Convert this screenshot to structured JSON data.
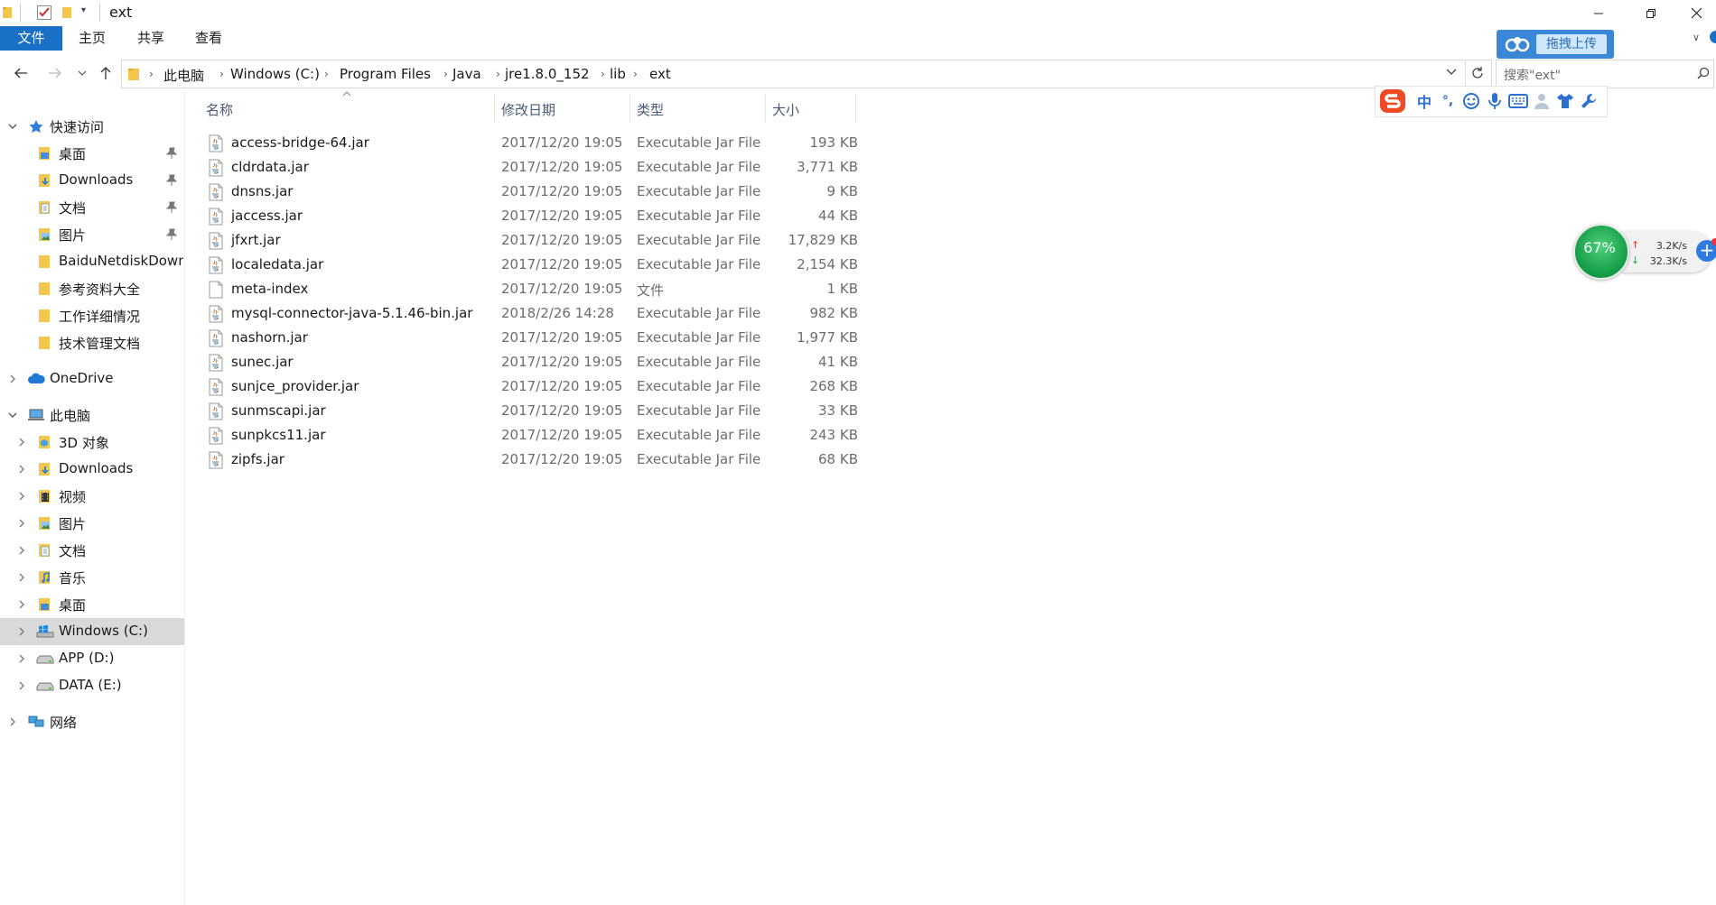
{
  "window": {
    "title": "ext"
  },
  "ribbon": {
    "tabs": [
      {
        "label": "文件",
        "active": true
      },
      {
        "label": "主页",
        "active": false
      },
      {
        "label": "共享",
        "active": false
      },
      {
        "label": "查看",
        "active": false
      }
    ]
  },
  "address": {
    "crumbs": [
      "此电脑",
      "Windows (C:)",
      "Program Files",
      "Java",
      "jre1.8.0_152",
      "lib",
      "ext"
    ]
  },
  "search": {
    "placeholder": "搜索\"ext\""
  },
  "baidu": {
    "label": "拖拽上传"
  },
  "ime": {
    "items": [
      "中",
      "°,",
      "☺",
      "mic",
      "keyboard",
      "user",
      "shirt",
      "wrench"
    ]
  },
  "columns": {
    "name": "名称",
    "date": "修改日期",
    "type": "类型",
    "size": "大小"
  },
  "files": [
    {
      "name": "access-bridge-64.jar",
      "date": "2017/12/20 19:05",
      "type": "Executable Jar File",
      "size": "193 KB",
      "icon": "jar-icon"
    },
    {
      "name": "cldrdata.jar",
      "date": "2017/12/20 19:05",
      "type": "Executable Jar File",
      "size": "3,771 KB",
      "icon": "jar-icon"
    },
    {
      "name": "dnsns.jar",
      "date": "2017/12/20 19:05",
      "type": "Executable Jar File",
      "size": "9 KB",
      "icon": "jar-icon"
    },
    {
      "name": "jaccess.jar",
      "date": "2017/12/20 19:05",
      "type": "Executable Jar File",
      "size": "44 KB",
      "icon": "jar-icon"
    },
    {
      "name": "jfxrt.jar",
      "date": "2017/12/20 19:05",
      "type": "Executable Jar File",
      "size": "17,829 KB",
      "icon": "jar-icon"
    },
    {
      "name": "localedata.jar",
      "date": "2017/12/20 19:05",
      "type": "Executable Jar File",
      "size": "2,154 KB",
      "icon": "jar-icon"
    },
    {
      "name": "meta-index",
      "date": "2017/12/20 19:05",
      "type": "文件",
      "size": "1 KB",
      "icon": "file-icon"
    },
    {
      "name": "mysql-connector-java-5.1.46-bin.jar",
      "date": "2018/2/26 14:28",
      "type": "Executable Jar File",
      "size": "982 KB",
      "icon": "jar-icon"
    },
    {
      "name": "nashorn.jar",
      "date": "2017/12/20 19:05",
      "type": "Executable Jar File",
      "size": "1,977 KB",
      "icon": "jar-icon"
    },
    {
      "name": "sunec.jar",
      "date": "2017/12/20 19:05",
      "type": "Executable Jar File",
      "size": "41 KB",
      "icon": "jar-icon"
    },
    {
      "name": "sunjce_provider.jar",
      "date": "2017/12/20 19:05",
      "type": "Executable Jar File",
      "size": "268 KB",
      "icon": "jar-icon"
    },
    {
      "name": "sunmscapi.jar",
      "date": "2017/12/20 19:05",
      "type": "Executable Jar File",
      "size": "33 KB",
      "icon": "jar-icon"
    },
    {
      "name": "sunpkcs11.jar",
      "date": "2017/12/20 19:05",
      "type": "Executable Jar File",
      "size": "243 KB",
      "icon": "jar-icon"
    },
    {
      "name": "zipfs.jar",
      "date": "2017/12/20 19:05",
      "type": "Executable Jar File",
      "size": "68 KB",
      "icon": "jar-icon"
    }
  ],
  "nav": [
    {
      "label": "快速访问",
      "icon": "star-icon",
      "level": 0,
      "chevron": "down"
    },
    {
      "label": "桌面",
      "icon": "desktop-folder-icon",
      "level": 1,
      "pinned": true
    },
    {
      "label": "Downloads",
      "icon": "downloads-folder-icon",
      "level": 1,
      "pinned": true
    },
    {
      "label": "文档",
      "icon": "documents-folder-icon",
      "level": 1,
      "pinned": true
    },
    {
      "label": "图片",
      "icon": "pictures-folder-icon",
      "level": 1,
      "pinned": true
    },
    {
      "label": "BaiduNetdiskDown",
      "icon": "folder-icon",
      "level": 1
    },
    {
      "label": "参考资料大全",
      "icon": "folder-icon",
      "level": 1
    },
    {
      "label": "工作详细情况",
      "icon": "folder-icon",
      "level": 1
    },
    {
      "label": "技术管理文档",
      "icon": "folder-icon",
      "level": 1
    },
    {
      "label": "OneDrive",
      "icon": "cloud-icon",
      "level": 0,
      "chevron": "right"
    },
    {
      "label": "此电脑",
      "icon": "computer-icon",
      "level": 0,
      "chevron": "down"
    },
    {
      "label": "3D 对象",
      "icon": "3d-objects-icon",
      "level": 1,
      "chevron": "right"
    },
    {
      "label": "Downloads",
      "icon": "downloads-folder-icon",
      "level": 1,
      "chevron": "right"
    },
    {
      "label": "视频",
      "icon": "video-folder-icon",
      "level": 1,
      "chevron": "right"
    },
    {
      "label": "图片",
      "icon": "pictures-folder-icon",
      "level": 1,
      "chevron": "right"
    },
    {
      "label": "文档",
      "icon": "documents-folder-icon",
      "level": 1,
      "chevron": "right"
    },
    {
      "label": "音乐",
      "icon": "music-folder-icon",
      "level": 1,
      "chevron": "right"
    },
    {
      "label": "桌面",
      "icon": "desktop-folder-icon",
      "level": 1,
      "chevron": "right"
    },
    {
      "label": "Windows (C:)",
      "icon": "windows-drive-icon",
      "level": 1,
      "chevron": "right",
      "selected": true
    },
    {
      "label": "APP (D:)",
      "icon": "drive-icon",
      "level": 1,
      "chevron": "right"
    },
    {
      "label": "DATA (E:)",
      "icon": "drive-icon",
      "level": 1,
      "chevron": "right"
    },
    {
      "label": "网络",
      "icon": "network-icon",
      "level": 0,
      "chevron": "right"
    }
  ],
  "netspeed": {
    "percent": "67%",
    "up": "3.2K/s",
    "down": "32.3K/s"
  },
  "colors": {
    "accent": "#1a6fc7",
    "folder": "#f4c64b",
    "selected": "#d9d9d9"
  }
}
